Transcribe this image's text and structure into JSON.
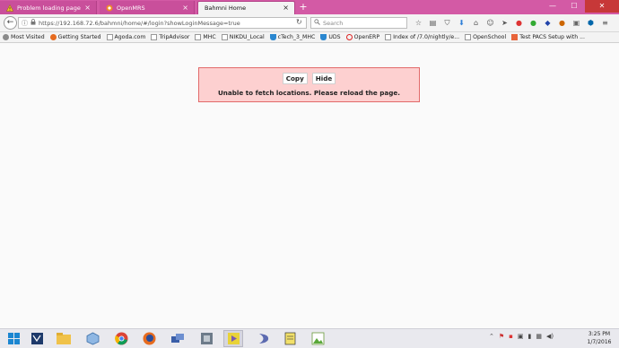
{
  "browser": {
    "tabs": [
      {
        "label": "Problem loading page",
        "icon": "warning-icon",
        "active": false
      },
      {
        "label": "OpenMRS",
        "icon": "openmrs-icon",
        "active": false
      },
      {
        "label": "Bahmni Home",
        "icon": "page-icon",
        "active": true
      }
    ],
    "url": "https://192.168.72.6/bahmni/home/#/login?showLoginMessage=true",
    "search_placeholder": "Search"
  },
  "bookmarks": [
    {
      "label": "Most Visited",
      "icon": "gear-icon"
    },
    {
      "label": "Getting Started",
      "icon": "firefox-icon"
    },
    {
      "label": "Agoda.com",
      "icon": "page-icon"
    },
    {
      "label": "TripAdvisor",
      "icon": "page-icon"
    },
    {
      "label": "MHC",
      "icon": "page-icon"
    },
    {
      "label": "NIKDU_Local",
      "icon": "page-icon"
    },
    {
      "label": "cTech_3_MHC",
      "icon": "shield-icon"
    },
    {
      "label": "UDS",
      "icon": "shield-icon"
    },
    {
      "label": "OpenERP",
      "icon": "opera-icon"
    },
    {
      "label": "Index of /7.0/nightly/e...",
      "icon": "page-icon"
    },
    {
      "label": "OpenSchool",
      "icon": "page-icon"
    },
    {
      "label": "Test PACS Setup with ...",
      "icon": "bookmark-icon"
    }
  ],
  "error": {
    "copy_label": "Copy",
    "hide_label": "Hide",
    "message": "Unable to fetch locations. Please reload the page."
  },
  "taskbar": {
    "time": "3:25 PM",
    "date": "1/7/2016",
    "apps": [
      "start-icon",
      "terminal-icon",
      "explorer-icon",
      "virtualbox-icon",
      "chrome-icon",
      "firefox-icon",
      "network-icon",
      "vmware-icon",
      "media-icon",
      "eclipse-icon",
      "notes-icon",
      "photo-icon"
    ]
  },
  "colors": {
    "accent": "#d35aa5",
    "error_bg": "#fdd0d0",
    "error_border": "#e26a6a"
  }
}
